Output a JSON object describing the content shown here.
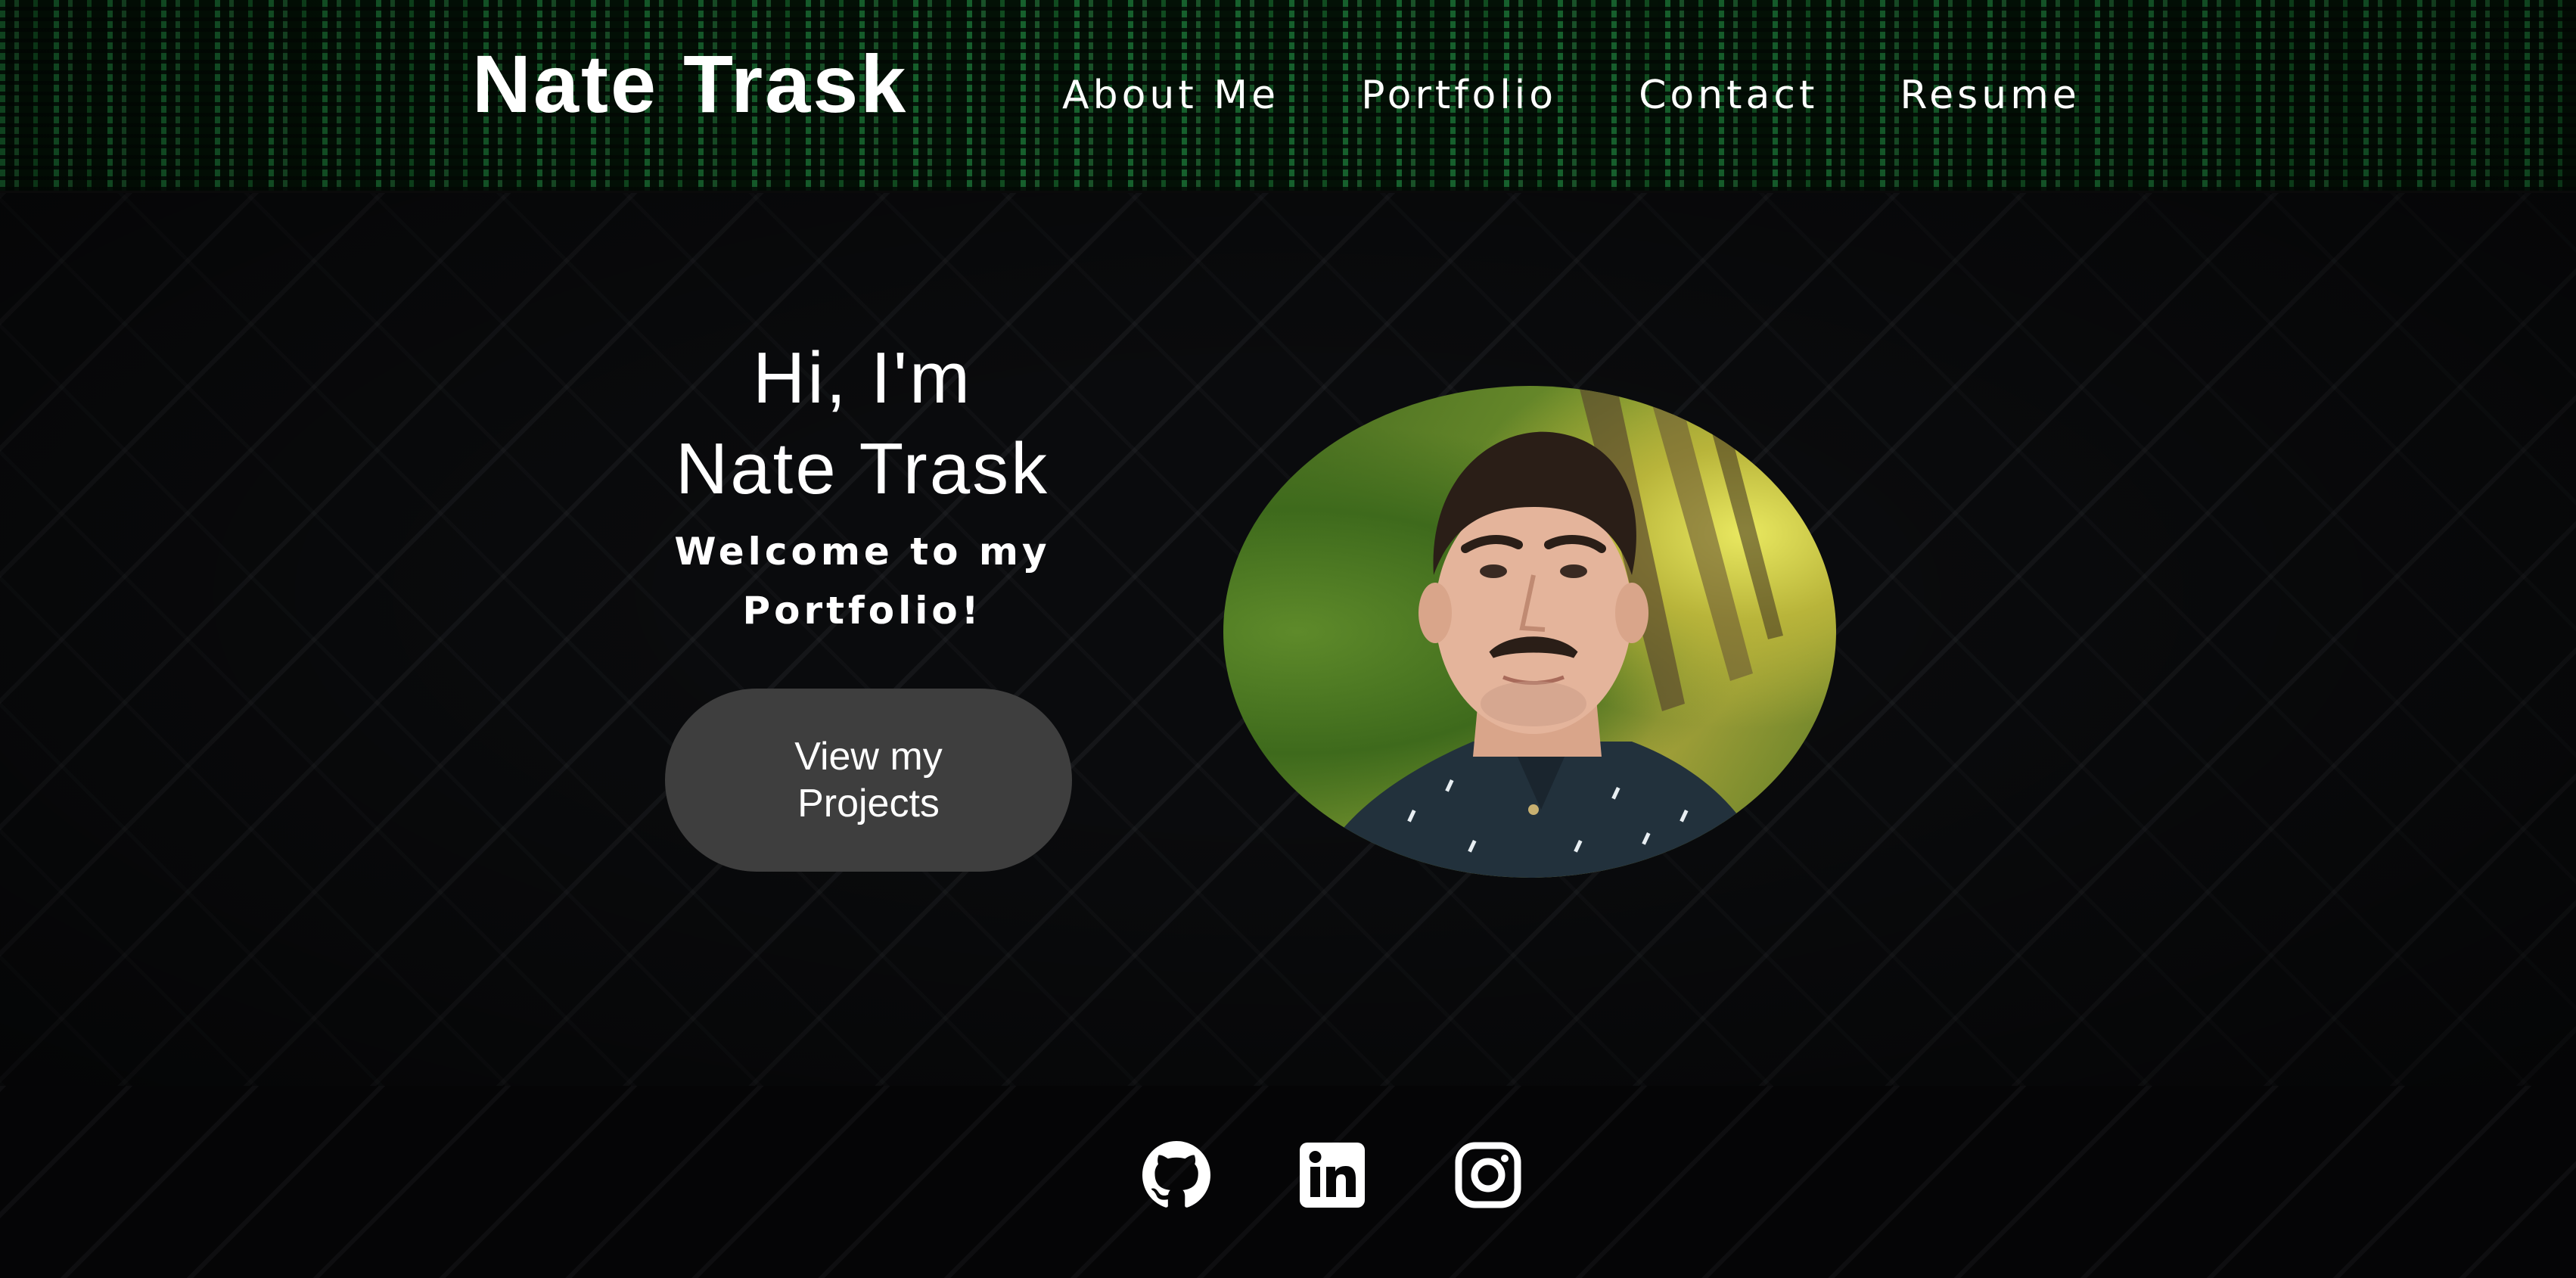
{
  "header": {
    "brand": "Nate Trask",
    "nav": [
      {
        "label": "About Me"
      },
      {
        "label": "Portfolio"
      },
      {
        "label": "Contact"
      },
      {
        "label": "Resume"
      }
    ]
  },
  "hero": {
    "greeting_line1": "Hi, I'm",
    "greeting_line2": "Nate Trask",
    "welcome": "Welcome to my Portfolio!",
    "cta_label": "View my Projects",
    "portrait_alt": "Portrait photo",
    "cta_color": "#3e3e3e"
  },
  "footer": {
    "social": [
      {
        "icon": "github-icon"
      },
      {
        "icon": "linkedin-icon"
      },
      {
        "icon": "instagram-icon"
      }
    ]
  },
  "colors": {
    "header_green": "#28aa50",
    "background": "#0a0b0d",
    "text": "#ffffff"
  }
}
